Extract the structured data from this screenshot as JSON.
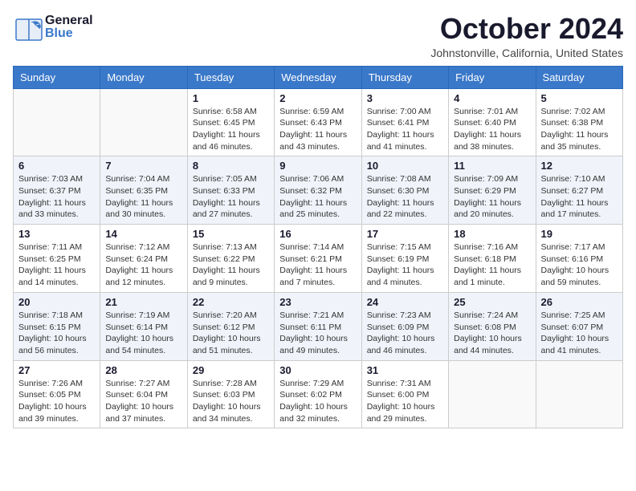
{
  "header": {
    "logo_general": "General",
    "logo_blue": "Blue",
    "month_title": "October 2024",
    "location": "Johnstonville, California, United States"
  },
  "weekdays": [
    "Sunday",
    "Monday",
    "Tuesday",
    "Wednesday",
    "Thursday",
    "Friday",
    "Saturday"
  ],
  "weeks": [
    {
      "row_class": "row-odd",
      "days": [
        {
          "num": "",
          "detail": "",
          "empty": true
        },
        {
          "num": "",
          "detail": "",
          "empty": true
        },
        {
          "num": "1",
          "detail": "Sunrise: 6:58 AM\nSunset: 6:45 PM\nDaylight: 11 hours and 46 minutes.",
          "empty": false
        },
        {
          "num": "2",
          "detail": "Sunrise: 6:59 AM\nSunset: 6:43 PM\nDaylight: 11 hours and 43 minutes.",
          "empty": false
        },
        {
          "num": "3",
          "detail": "Sunrise: 7:00 AM\nSunset: 6:41 PM\nDaylight: 11 hours and 41 minutes.",
          "empty": false
        },
        {
          "num": "4",
          "detail": "Sunrise: 7:01 AM\nSunset: 6:40 PM\nDaylight: 11 hours and 38 minutes.",
          "empty": false
        },
        {
          "num": "5",
          "detail": "Sunrise: 7:02 AM\nSunset: 6:38 PM\nDaylight: 11 hours and 35 minutes.",
          "empty": false
        }
      ]
    },
    {
      "row_class": "row-even",
      "days": [
        {
          "num": "6",
          "detail": "Sunrise: 7:03 AM\nSunset: 6:37 PM\nDaylight: 11 hours and 33 minutes.",
          "empty": false
        },
        {
          "num": "7",
          "detail": "Sunrise: 7:04 AM\nSunset: 6:35 PM\nDaylight: 11 hours and 30 minutes.",
          "empty": false
        },
        {
          "num": "8",
          "detail": "Sunrise: 7:05 AM\nSunset: 6:33 PM\nDaylight: 11 hours and 27 minutes.",
          "empty": false
        },
        {
          "num": "9",
          "detail": "Sunrise: 7:06 AM\nSunset: 6:32 PM\nDaylight: 11 hours and 25 minutes.",
          "empty": false
        },
        {
          "num": "10",
          "detail": "Sunrise: 7:08 AM\nSunset: 6:30 PM\nDaylight: 11 hours and 22 minutes.",
          "empty": false
        },
        {
          "num": "11",
          "detail": "Sunrise: 7:09 AM\nSunset: 6:29 PM\nDaylight: 11 hours and 20 minutes.",
          "empty": false
        },
        {
          "num": "12",
          "detail": "Sunrise: 7:10 AM\nSunset: 6:27 PM\nDaylight: 11 hours and 17 minutes.",
          "empty": false
        }
      ]
    },
    {
      "row_class": "row-odd",
      "days": [
        {
          "num": "13",
          "detail": "Sunrise: 7:11 AM\nSunset: 6:25 PM\nDaylight: 11 hours and 14 minutes.",
          "empty": false
        },
        {
          "num": "14",
          "detail": "Sunrise: 7:12 AM\nSunset: 6:24 PM\nDaylight: 11 hours and 12 minutes.",
          "empty": false
        },
        {
          "num": "15",
          "detail": "Sunrise: 7:13 AM\nSunset: 6:22 PM\nDaylight: 11 hours and 9 minutes.",
          "empty": false
        },
        {
          "num": "16",
          "detail": "Sunrise: 7:14 AM\nSunset: 6:21 PM\nDaylight: 11 hours and 7 minutes.",
          "empty": false
        },
        {
          "num": "17",
          "detail": "Sunrise: 7:15 AM\nSunset: 6:19 PM\nDaylight: 11 hours and 4 minutes.",
          "empty": false
        },
        {
          "num": "18",
          "detail": "Sunrise: 7:16 AM\nSunset: 6:18 PM\nDaylight: 11 hours and 1 minute.",
          "empty": false
        },
        {
          "num": "19",
          "detail": "Sunrise: 7:17 AM\nSunset: 6:16 PM\nDaylight: 10 hours and 59 minutes.",
          "empty": false
        }
      ]
    },
    {
      "row_class": "row-even",
      "days": [
        {
          "num": "20",
          "detail": "Sunrise: 7:18 AM\nSunset: 6:15 PM\nDaylight: 10 hours and 56 minutes.",
          "empty": false
        },
        {
          "num": "21",
          "detail": "Sunrise: 7:19 AM\nSunset: 6:14 PM\nDaylight: 10 hours and 54 minutes.",
          "empty": false
        },
        {
          "num": "22",
          "detail": "Sunrise: 7:20 AM\nSunset: 6:12 PM\nDaylight: 10 hours and 51 minutes.",
          "empty": false
        },
        {
          "num": "23",
          "detail": "Sunrise: 7:21 AM\nSunset: 6:11 PM\nDaylight: 10 hours and 49 minutes.",
          "empty": false
        },
        {
          "num": "24",
          "detail": "Sunrise: 7:23 AM\nSunset: 6:09 PM\nDaylight: 10 hours and 46 minutes.",
          "empty": false
        },
        {
          "num": "25",
          "detail": "Sunrise: 7:24 AM\nSunset: 6:08 PM\nDaylight: 10 hours and 44 minutes.",
          "empty": false
        },
        {
          "num": "26",
          "detail": "Sunrise: 7:25 AM\nSunset: 6:07 PM\nDaylight: 10 hours and 41 minutes.",
          "empty": false
        }
      ]
    },
    {
      "row_class": "row-odd",
      "days": [
        {
          "num": "27",
          "detail": "Sunrise: 7:26 AM\nSunset: 6:05 PM\nDaylight: 10 hours and 39 minutes.",
          "empty": false
        },
        {
          "num": "28",
          "detail": "Sunrise: 7:27 AM\nSunset: 6:04 PM\nDaylight: 10 hours and 37 minutes.",
          "empty": false
        },
        {
          "num": "29",
          "detail": "Sunrise: 7:28 AM\nSunset: 6:03 PM\nDaylight: 10 hours and 34 minutes.",
          "empty": false
        },
        {
          "num": "30",
          "detail": "Sunrise: 7:29 AM\nSunset: 6:02 PM\nDaylight: 10 hours and 32 minutes.",
          "empty": false
        },
        {
          "num": "31",
          "detail": "Sunrise: 7:31 AM\nSunset: 6:00 PM\nDaylight: 10 hours and 29 minutes.",
          "empty": false
        },
        {
          "num": "",
          "detail": "",
          "empty": true
        },
        {
          "num": "",
          "detail": "",
          "empty": true
        }
      ]
    }
  ]
}
